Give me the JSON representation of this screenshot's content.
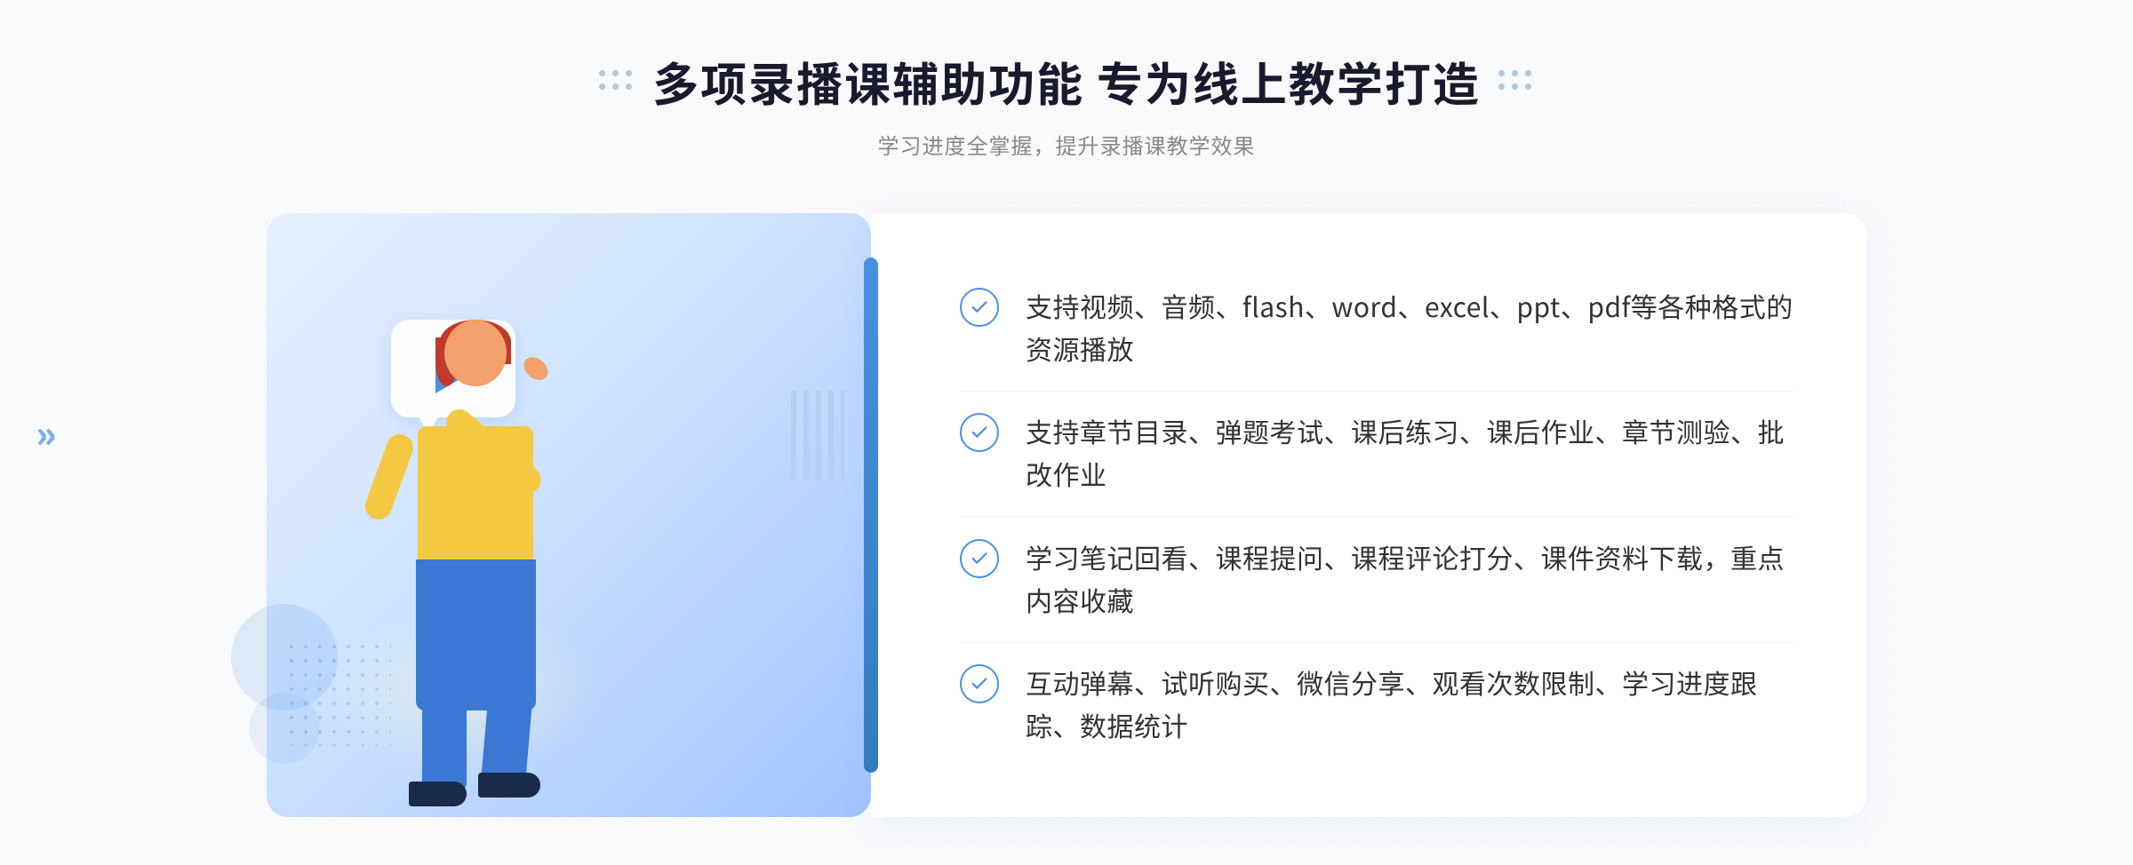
{
  "header": {
    "title": "多项录播课辅助功能 专为线上教学打造",
    "subtitle": "学习进度全掌握，提升录播课教学效果"
  },
  "features": [
    {
      "id": "feature-1",
      "text": "支持视频、音频、flash、word、excel、ppt、pdf等各种格式的资源播放"
    },
    {
      "id": "feature-2",
      "text": "支持章节目录、弹题考试、课后练习、课后作业、章节测验、批改作业"
    },
    {
      "id": "feature-3",
      "text": "学习笔记回看、课程提问、课程评论打分、课件资料下载，重点内容收藏"
    },
    {
      "id": "feature-4",
      "text": "互动弹幕、试听购买、微信分享、观看次数限制、学习进度跟踪、数据统计"
    }
  ],
  "decorations": {
    "chevron_left": "»",
    "check_color": "#4a90e2"
  }
}
